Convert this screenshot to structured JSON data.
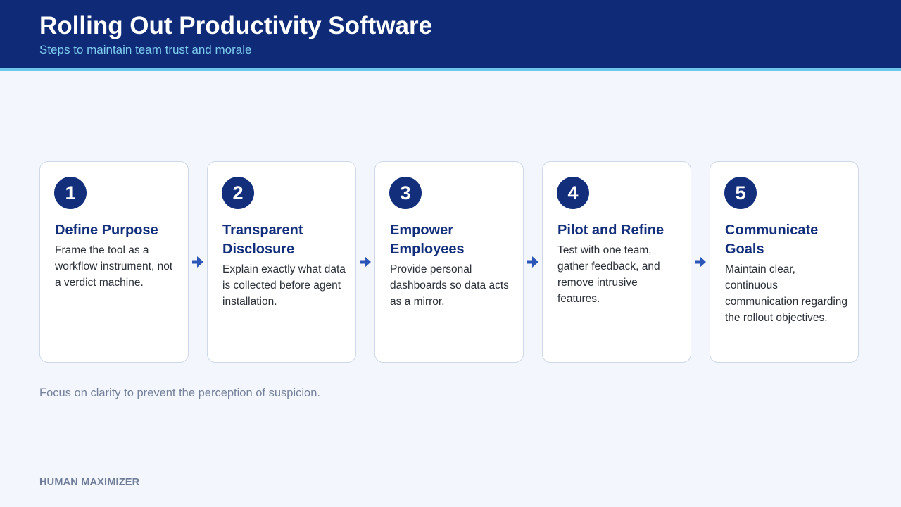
{
  "header": {
    "title": "Rolling Out Productivity Software",
    "subtitle": "Steps to maintain team trust and morale"
  },
  "steps": [
    {
      "number": "1",
      "title": "Define Purpose",
      "description": "Frame the tool as a workflow instrument, not a verdict machine."
    },
    {
      "number": "2",
      "title": "Transparent Disclosure",
      "description": "Explain exactly what data is collected before agent installation."
    },
    {
      "number": "3",
      "title": "Empower Employees",
      "description": "Provide personal dashboards so data acts as a mirror."
    },
    {
      "number": "4",
      "title": "Pilot and Refine",
      "description": "Test with one team, gather feedback, and remove intrusive features."
    },
    {
      "number": "5",
      "title": "Communicate Goals",
      "description": "Maintain clear, continuous communication regarding the rollout objectives."
    }
  ],
  "connector_icon": "arrow-right-icon",
  "footnote": "Focus on clarity to prevent the perception of suspicion.",
  "brand": "HUMAN MAXIMIZER",
  "colors": {
    "header_bg": "#0f2b78",
    "accent": "#6cc7ea",
    "step_circle": "#132f7c",
    "arrow": "#2c55b8",
    "page_bg": "#f3f7fd"
  }
}
